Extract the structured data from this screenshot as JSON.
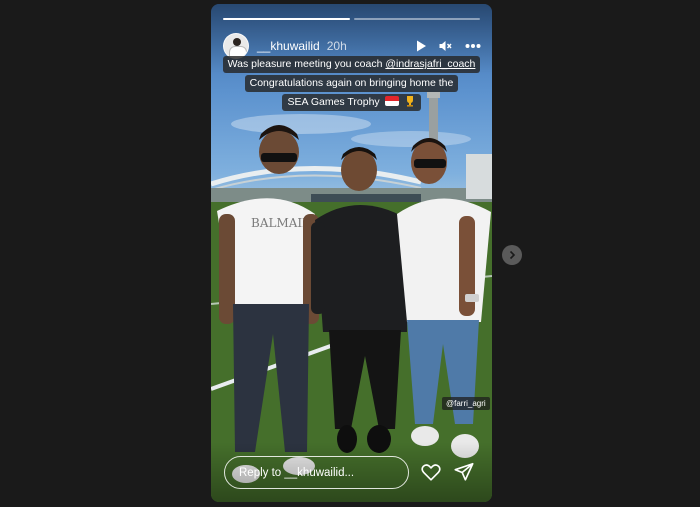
{
  "story": {
    "progress": [
      1.0,
      0.0
    ],
    "header": {
      "username": "__khuwailid",
      "time": "20h",
      "icons": [
        "play-icon",
        "mute-icon",
        "more-icon"
      ]
    },
    "caption": {
      "line1_text": "Was pleasure meeting you coach ",
      "line1_mention": "@indrasjafri_coach",
      "line2": "Congratulations again on bringing home the",
      "line3_text": "SEA Games Trophy",
      "line3_emojis": [
        "indonesia-flag-emoji",
        "trophy-emoji"
      ]
    },
    "shirt_text": "BALMAIN",
    "tag": "@farri_agri",
    "reply_placeholder": "Reply to __khuwailid...",
    "actions": [
      "heart-icon",
      "send-icon"
    ],
    "nav": [
      "next-story-icon"
    ]
  }
}
